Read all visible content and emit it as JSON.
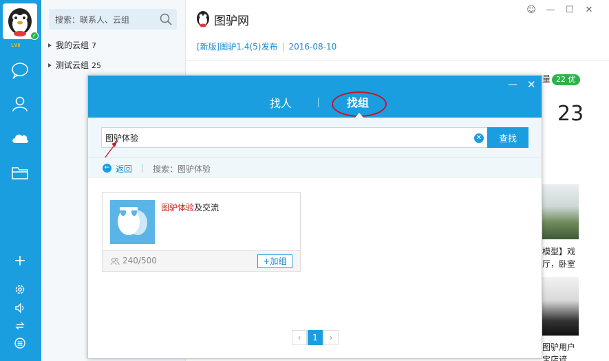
{
  "rail": {
    "level": "LV8",
    "colors": {
      "bg": "#1a9ee0",
      "online": "#2bb34a"
    }
  },
  "contacts": {
    "search_placeholder": "搜索：联系人、云组",
    "groups": [
      {
        "label": "我的云组",
        "count": "7"
      },
      {
        "label": "测试云组",
        "count": "25"
      }
    ]
  },
  "main": {
    "title": "图驴网",
    "news": {
      "tag": "[新版]图驴1.4(5)发布",
      "date": "2016-08-10"
    },
    "quality_label": "量",
    "quality_badge": "22 优",
    "big_number": "23",
    "thumb1_caption": [
      "模型】戏",
      "厅，卧室"
    ],
    "thumb2_caption": [
      "图驴用户",
      "宝店谚"
    ]
  },
  "dialog": {
    "tabs": {
      "person": "找人",
      "group": "找组"
    },
    "search": {
      "value": "图驴体验",
      "button": "查找"
    },
    "back": "返回",
    "crumb": "搜索：图驴体验",
    "result": {
      "name_highlight": "图驴体验",
      "name_rest": "及交流",
      "members": "240/500",
      "join": "+加组"
    },
    "pager": {
      "current": "1"
    }
  }
}
